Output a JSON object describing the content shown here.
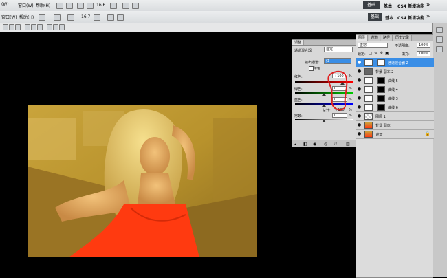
{
  "menubar": {
    "items": [
      "(W)",
      "窗口(W)",
      "帮助(H)"
    ],
    "zoom": "16.6",
    "workspace_active": "基础",
    "workspace_items": [
      "基本",
      "CS4 新增功能"
    ],
    "expand": "»"
  },
  "optionsbar": {
    "items": [
      "窗口(W)",
      "帮助(H)"
    ],
    "zoom": "16.7",
    "workspace_active": "基础",
    "workspace_items": [
      "基本",
      "CS4 新增功能"
    ],
    "expand": "»"
  },
  "adjust_panel": {
    "tab": "调整",
    "title": "通道混合器",
    "preset": "自定",
    "output_label": "输出通道:",
    "output_value": "红",
    "mono_label": "单色",
    "red_label": "红色:",
    "red_value": "+100",
    "green_label": "绿色:",
    "green_value": "0",
    "blue_label": "蓝色:",
    "blue_value": "0",
    "pct": "%",
    "total_label": "总计:",
    "total_value": "+100",
    "constant_label": "常数:",
    "constant_value": "0",
    "slider_fraction": {
      "red": 0.82,
      "green": 0.5,
      "blue": 0.5,
      "constant": 0.5
    }
  },
  "layers_panel": {
    "tabs": [
      "图层",
      "通道",
      "路径",
      "历史记录"
    ],
    "blend_mode": "正常",
    "opacity_label": "不透明度:",
    "opacity_value": "100%",
    "lock_label": "锁定:",
    "fill_label": "填充:",
    "fill_value": "100%",
    "layers": [
      {
        "name": "通道混合器 2",
        "selected": true
      },
      {
        "name": "背景 副本 2",
        "selected": false
      },
      {
        "name": "曲线 5",
        "selected": false
      },
      {
        "name": "曲线 4",
        "selected": false
      },
      {
        "name": "曲线 3",
        "selected": false
      },
      {
        "name": "曲线 6",
        "selected": false
      },
      {
        "name": "图层 1",
        "selected": false
      },
      {
        "name": "背景 副本",
        "selected": false
      },
      {
        "name": "背景",
        "selected": false
      }
    ]
  },
  "colors": {
    "selected_layer": "#3a8ee6",
    "annotation": "#e02020",
    "photo_bg": "#b8922c",
    "dress": "#ff3a10"
  }
}
